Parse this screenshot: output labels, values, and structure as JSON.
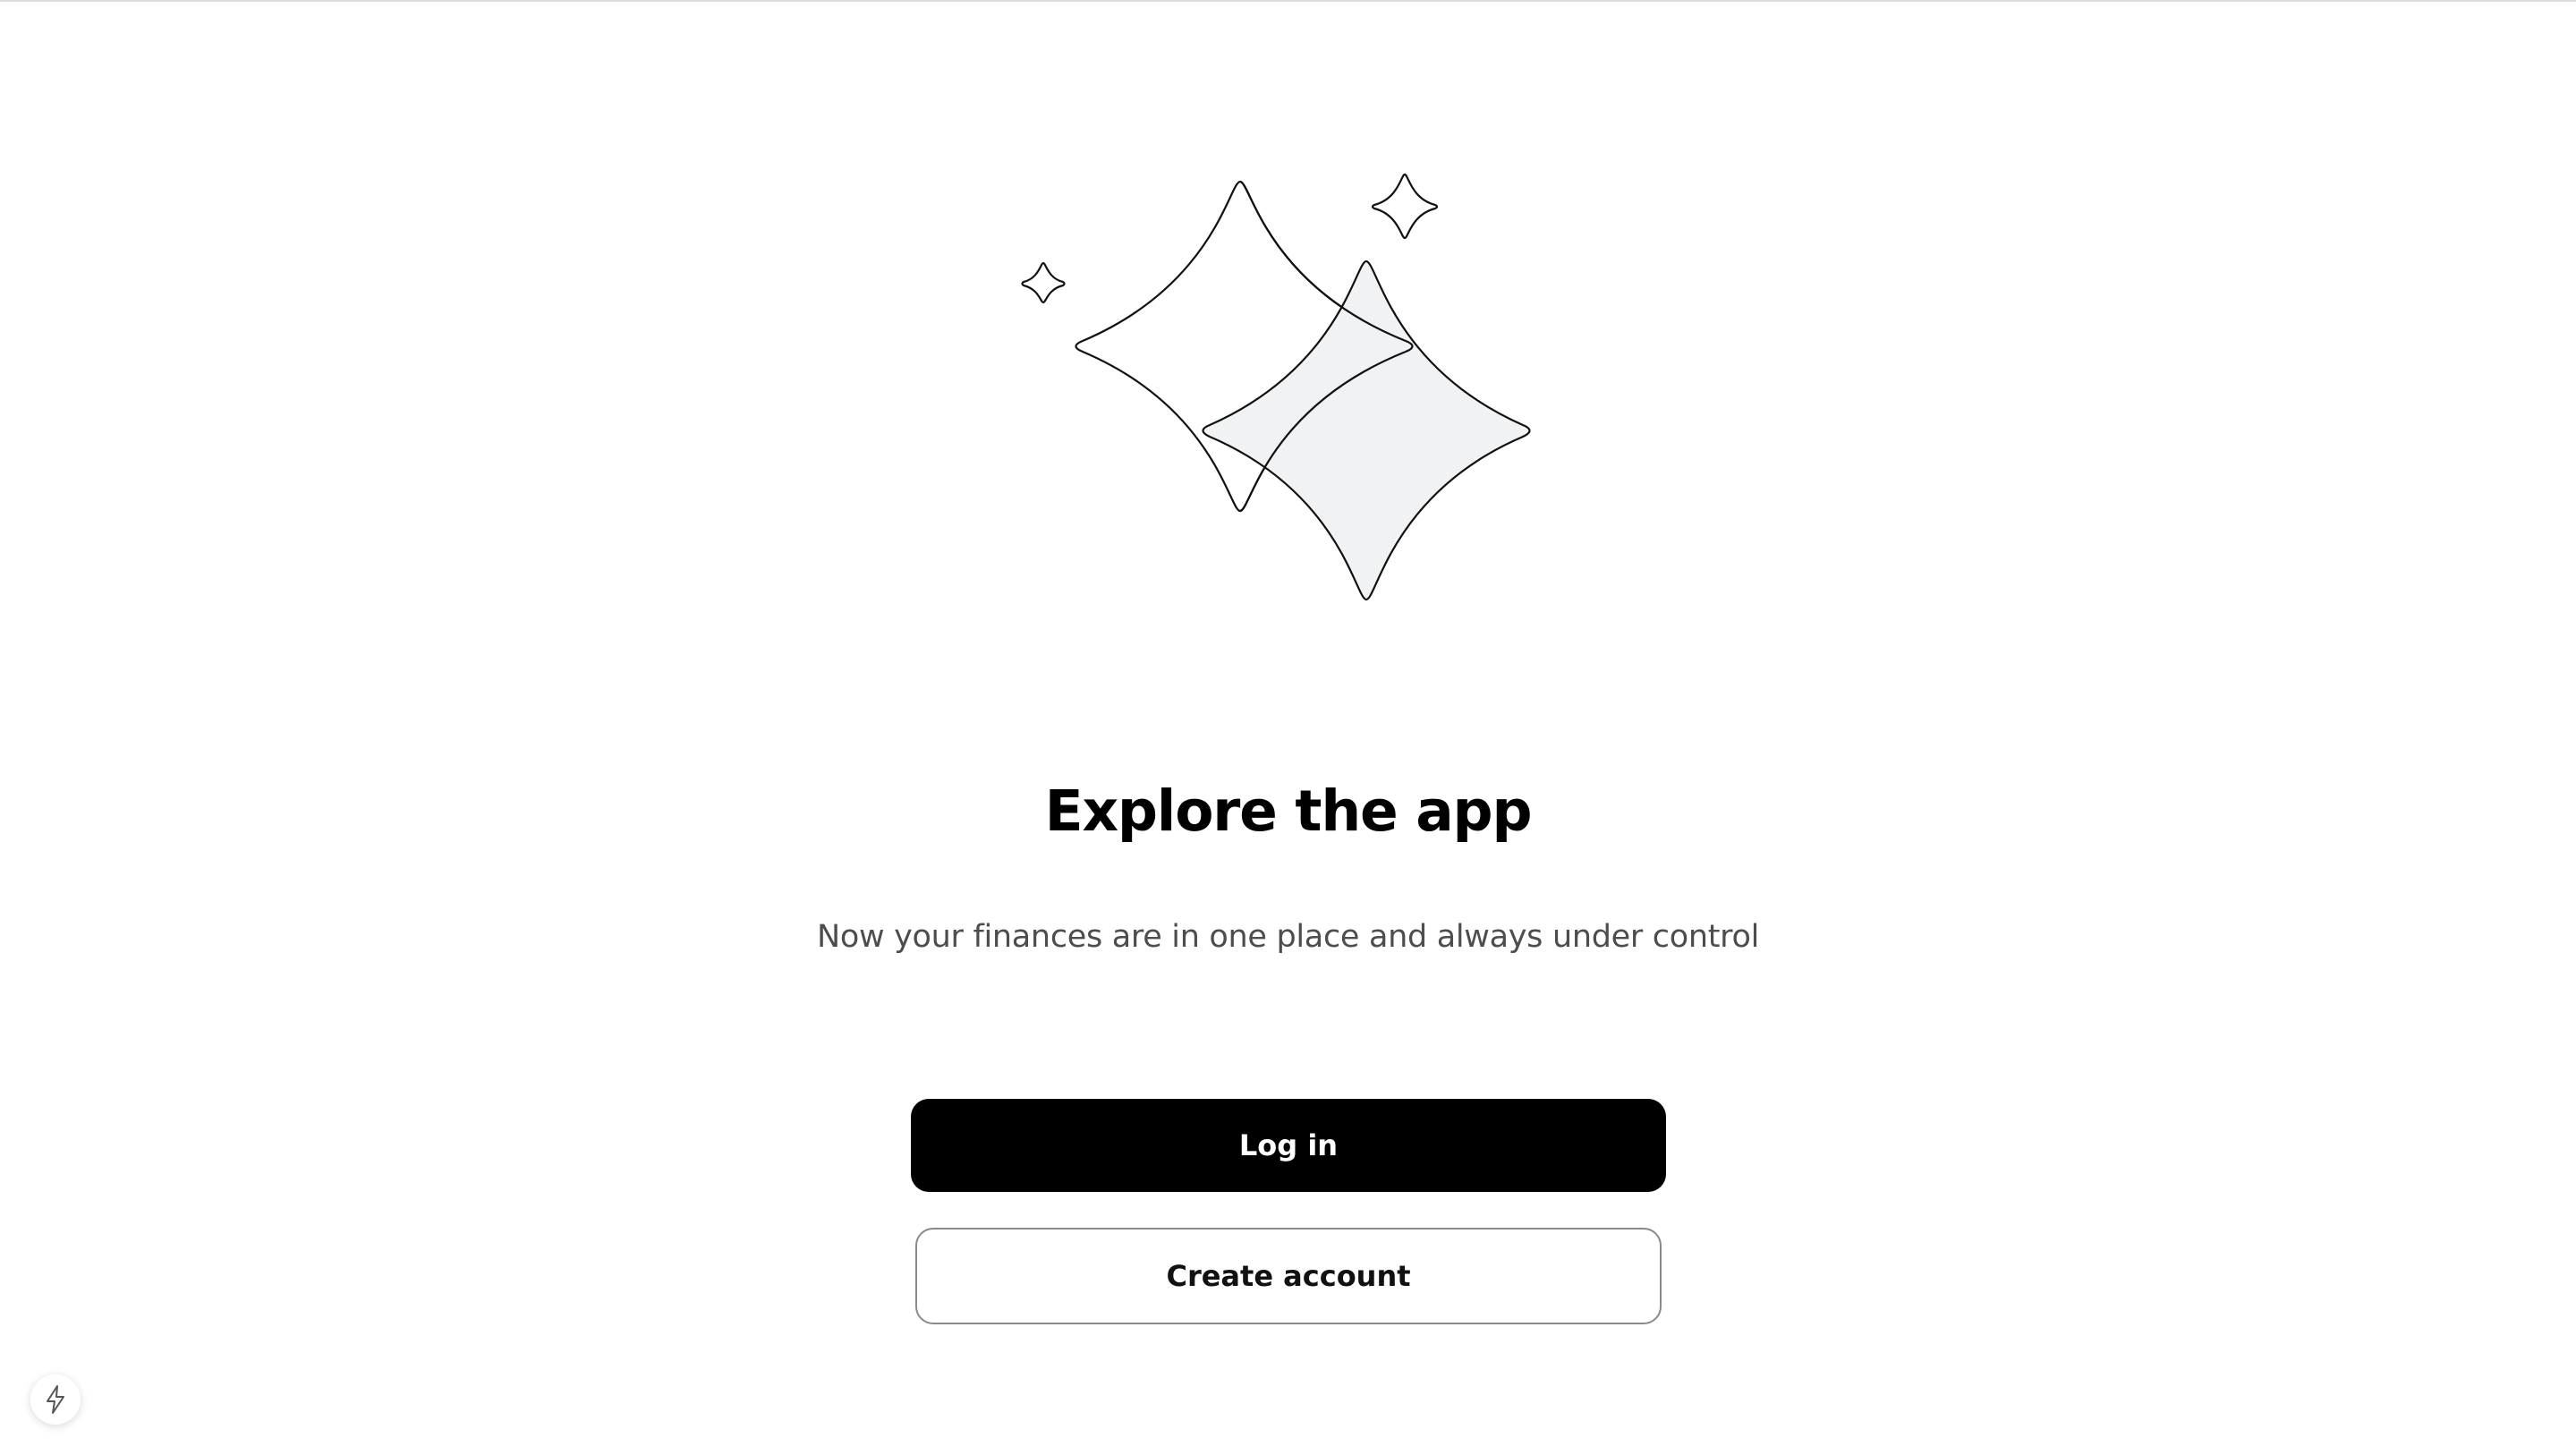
{
  "hero": {
    "illustration_icon": "sparkles-icon",
    "title": "Explore the app",
    "subtitle": "Now your finances are in one place and always under control"
  },
  "actions": {
    "login_label": "Log in",
    "create_account_label": "Create account"
  },
  "dev_tools": {
    "icon": "lightning-bolt-icon"
  },
  "colors": {
    "primary_button_bg": "#000000",
    "primary_button_text": "#ffffff",
    "secondary_button_border": "#8a8a8a",
    "sparkle_fill": "#f1f2f3",
    "subtitle_text": "#4d4d4d"
  }
}
